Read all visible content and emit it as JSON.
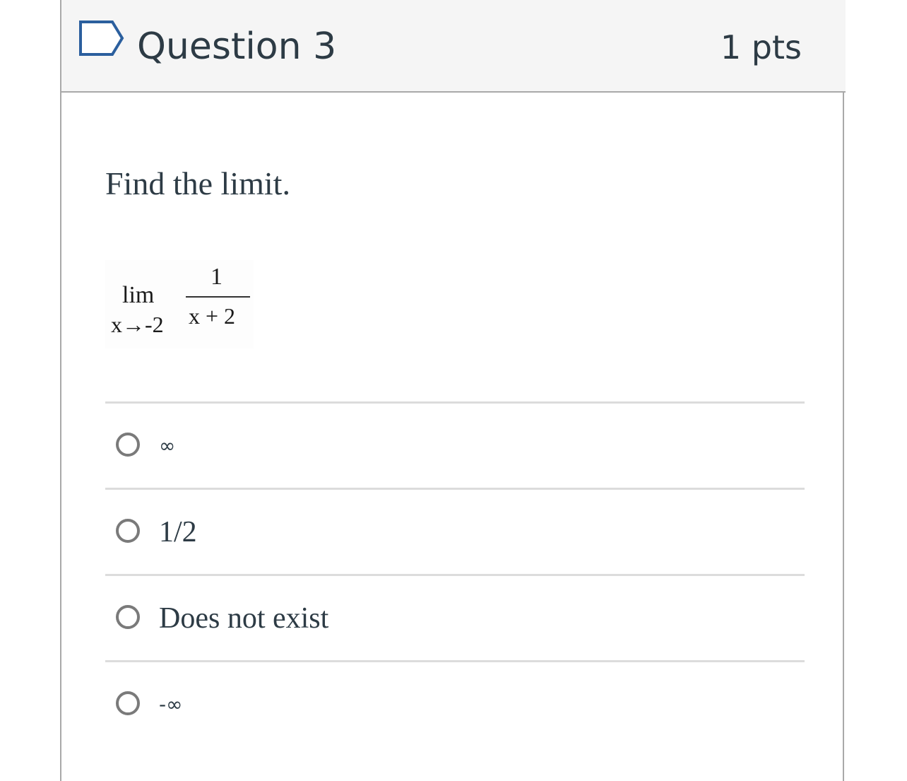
{
  "header": {
    "title": "Question 3",
    "points": "1 pts",
    "flag_icon": "flag-question-icon"
  },
  "question": {
    "prompt": "Find the limit.",
    "math": {
      "lim": "lim",
      "approach": "x→-2",
      "numerator": "1",
      "denominator": "x + 2"
    }
  },
  "answers": [
    {
      "label": "∞"
    },
    {
      "label": "1/2"
    },
    {
      "label": "Does not exist"
    },
    {
      "label": "-∞"
    }
  ],
  "colors": {
    "header_bg": "#f5f5f5",
    "text": "#2d3b45",
    "border": "#a9a9a9",
    "flag": "#2b5f9e"
  }
}
